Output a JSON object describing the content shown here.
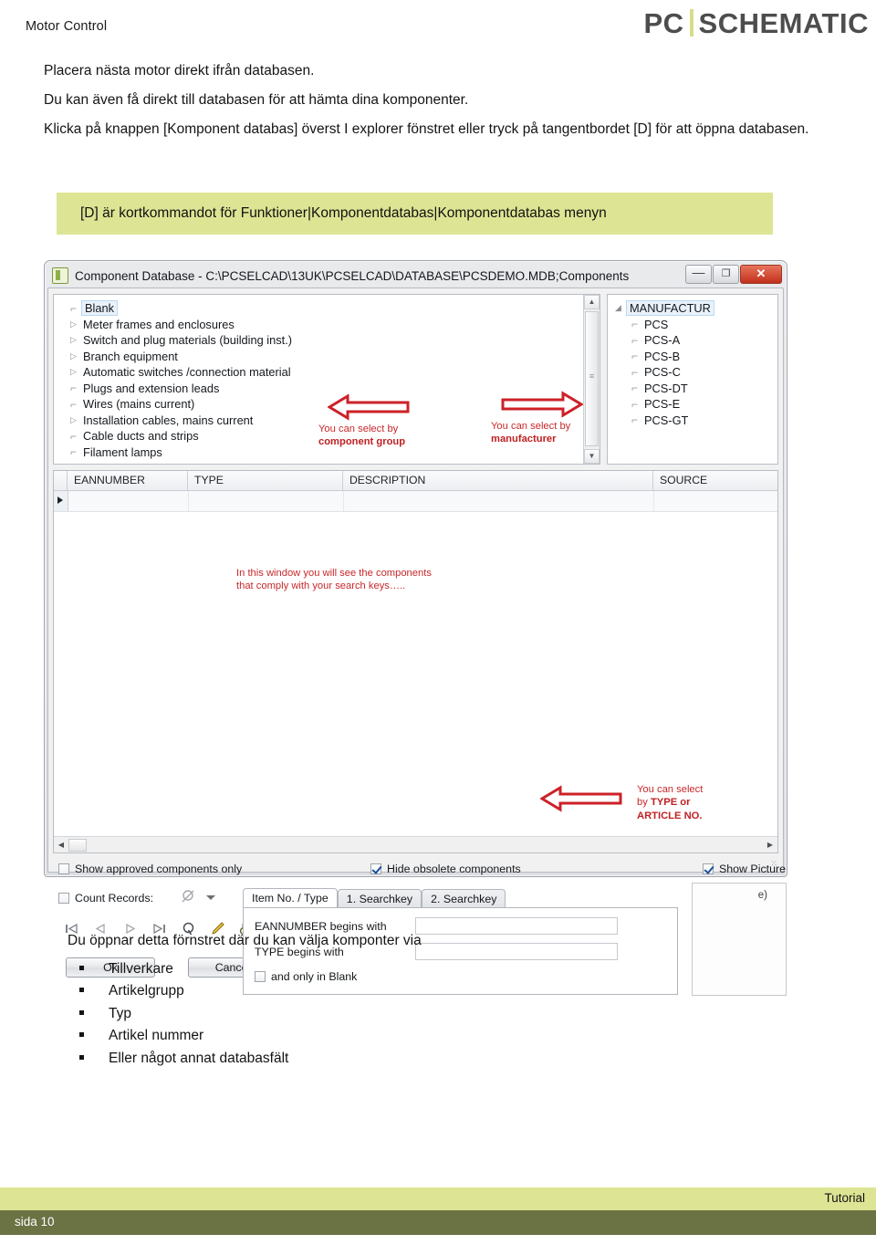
{
  "header": {
    "doc_title": "Motor Control",
    "brand_left": "PC",
    "brand_right": "SCHEMATIC",
    "brand_separator_color": "#d7dc8a"
  },
  "intro": {
    "line1": "Placera nästa motor direkt ifrån databasen.",
    "line2": "Du kan även få direkt till databasen för att hämta dina komponenter.",
    "line3": "Klicka på knappen [Komponent databas] överst I explorer fönstret eller tryck på tangentbordet [D] för att öppna databasen."
  },
  "callout": {
    "text": "[D] är kortkommandot för Funktioner|Komponentdatabas|Komponentdatabas menyn",
    "background": "#dde594"
  },
  "app_window": {
    "title": "Component Database - C:\\PCSELCAD\\13UK\\PCSELCAD\\DATABASE\\PCSDEMO.MDB;Components",
    "window_buttons": {
      "minimize": "—",
      "maximize": "❐",
      "close": "✕"
    },
    "tree": {
      "items": [
        {
          "label": "Blank",
          "expandable": false,
          "selected": true
        },
        {
          "label": "Meter frames and enclosures",
          "expandable": true,
          "selected": false
        },
        {
          "label": "Switch and plug materials (building inst.)",
          "expandable": true,
          "selected": false
        },
        {
          "label": "Branch equipment",
          "expandable": true,
          "selected": false
        },
        {
          "label": "Automatic switches /connection material",
          "expandable": true,
          "selected": false
        },
        {
          "label": "Plugs and extension leads",
          "expandable": false,
          "selected": false
        },
        {
          "label": "Wires (mains current)",
          "expandable": false,
          "selected": false
        },
        {
          "label": "Installation cables, mains current",
          "expandable": true,
          "selected": false
        },
        {
          "label": "Cable ducts and strips",
          "expandable": false,
          "selected": false
        },
        {
          "label": "Filament lamps",
          "expandable": false,
          "selected": false
        }
      ]
    },
    "manufacturer_tree": {
      "root": "MANUFACTUR",
      "items": [
        "PCS",
        "PCS-A",
        "PCS-B",
        "PCS-C",
        "PCS-DT",
        "PCS-E",
        "PCS-GT"
      ]
    },
    "grid": {
      "columns": [
        "EANNUMBER",
        "TYPE",
        "DESCRIPTION",
        "SOURCE"
      ],
      "rows": [
        [
          "",
          "",
          "",
          ""
        ]
      ]
    },
    "checkboxes": {
      "show_approved": {
        "label": "Show approved components only",
        "checked": false
      },
      "count_records": {
        "label": "Count Records:",
        "checked": false
      },
      "hide_obsolete": {
        "label": "Hide obsolete components",
        "checked": true
      },
      "show_picture": {
        "label": "Show Picture",
        "checked": true
      }
    },
    "tabs": [
      {
        "label": "Item No. / Type",
        "active": true
      },
      {
        "label": "1. Searchkey",
        "active": false
      },
      {
        "label": "2. Searchkey",
        "active": false
      }
    ],
    "search_fields": [
      {
        "label": "EANNUMBER begins with",
        "value": ""
      },
      {
        "label": "TYPE begins with",
        "value": ""
      }
    ],
    "only_blank": {
      "label": "and only in Blank",
      "checked": false
    },
    "buttons": {
      "ok": "Ok",
      "cancel": "Cancel"
    },
    "nav_icons": [
      "first-record-icon",
      "previous-record-icon",
      "next-record-icon",
      "last-record-icon",
      "refresh-icon",
      "edit-pencil-icon",
      "binoculars-search-icon"
    ],
    "picture_note": "e)"
  },
  "annotations": {
    "component_group": {
      "line1": "You can select by",
      "line2": "component group"
    },
    "manufacturer": {
      "line1": "You can select by",
      "line2": "manufacturer"
    },
    "components_window": {
      "line1": "In this window you will see the components",
      "line2": "that comply with your search keys….."
    },
    "type_article": {
      "line1": "You can select",
      "line2": "by ",
      "line2b": "TYPE or",
      "line3": "ARTICLE NO."
    },
    "color": "#c8282b"
  },
  "outro": {
    "lead": "Du öppnar detta förnstret där du kan välja komponter via",
    "items": [
      "Tillverkare",
      "Artikelgrupp",
      "Typ",
      "Artikel nummer",
      "Eller något annat databasfält"
    ]
  },
  "footer": {
    "tutorial": "Tutorial",
    "page": "sida 10",
    "top_band_color": "#dde594",
    "bottom_band_color": "#6b7243"
  }
}
